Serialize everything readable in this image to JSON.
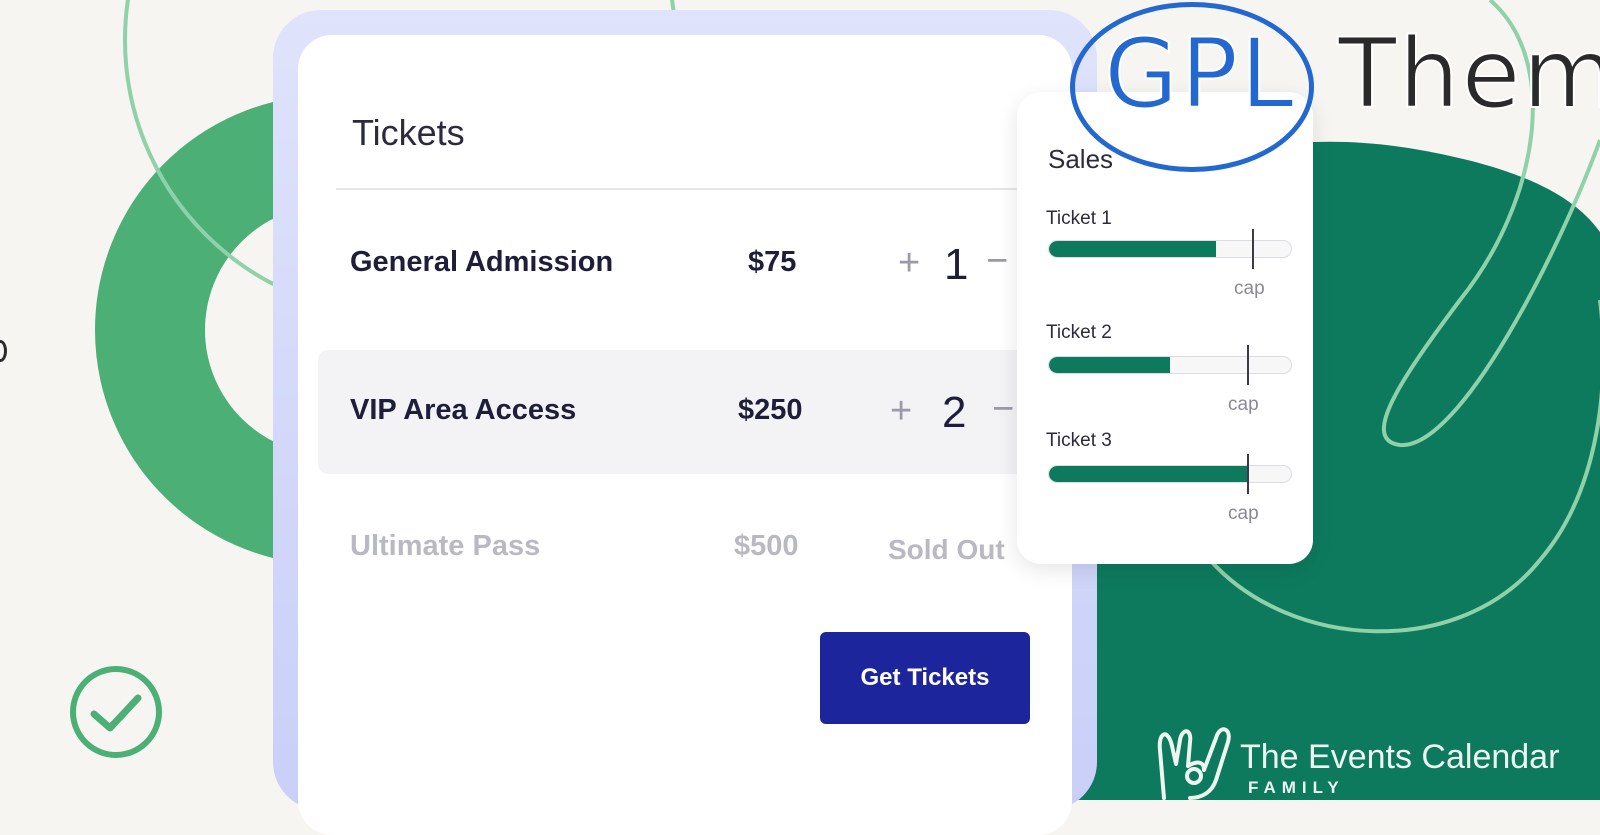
{
  "tickets": {
    "title": "Tickets",
    "rows": [
      {
        "name": "General Admission",
        "price": "$75",
        "plus": "+",
        "qty": "1",
        "minus": "−"
      },
      {
        "name": "VIP Area Access",
        "price": "$250",
        "plus": "+",
        "qty": "2",
        "minus": "−"
      },
      {
        "name": "Ultimate Pass",
        "price": "$500",
        "status": "Sold Out"
      }
    ],
    "button_label": "Get Tickets"
  },
  "sales": {
    "title": "Sales",
    "items": [
      {
        "label": "Ticket 1",
        "fill_fraction": 0.69,
        "cap_fraction": 0.84,
        "cap_label": "cap"
      },
      {
        "label": "Ticket 2",
        "fill_fraction": 0.5,
        "cap_fraction": 0.82,
        "cap_label": "cap"
      },
      {
        "label": "Ticket 3",
        "fill_fraction": 0.82,
        "cap_fraction": 0.82,
        "cap_label": "cap"
      }
    ]
  },
  "watermark": {
    "gpl": "GPL",
    "them": "Them"
  },
  "brand": {
    "name": "The Events Calendar",
    "sub": "FAMILY"
  },
  "colors": {
    "accent_green": "#0d7a5e",
    "button_blue": "#1c259b",
    "watermark_blue": "#2367d1",
    "background": "#f6f5f2"
  },
  "icons": [
    "check-circle-icon",
    "rock-hand-logo-icon"
  ]
}
